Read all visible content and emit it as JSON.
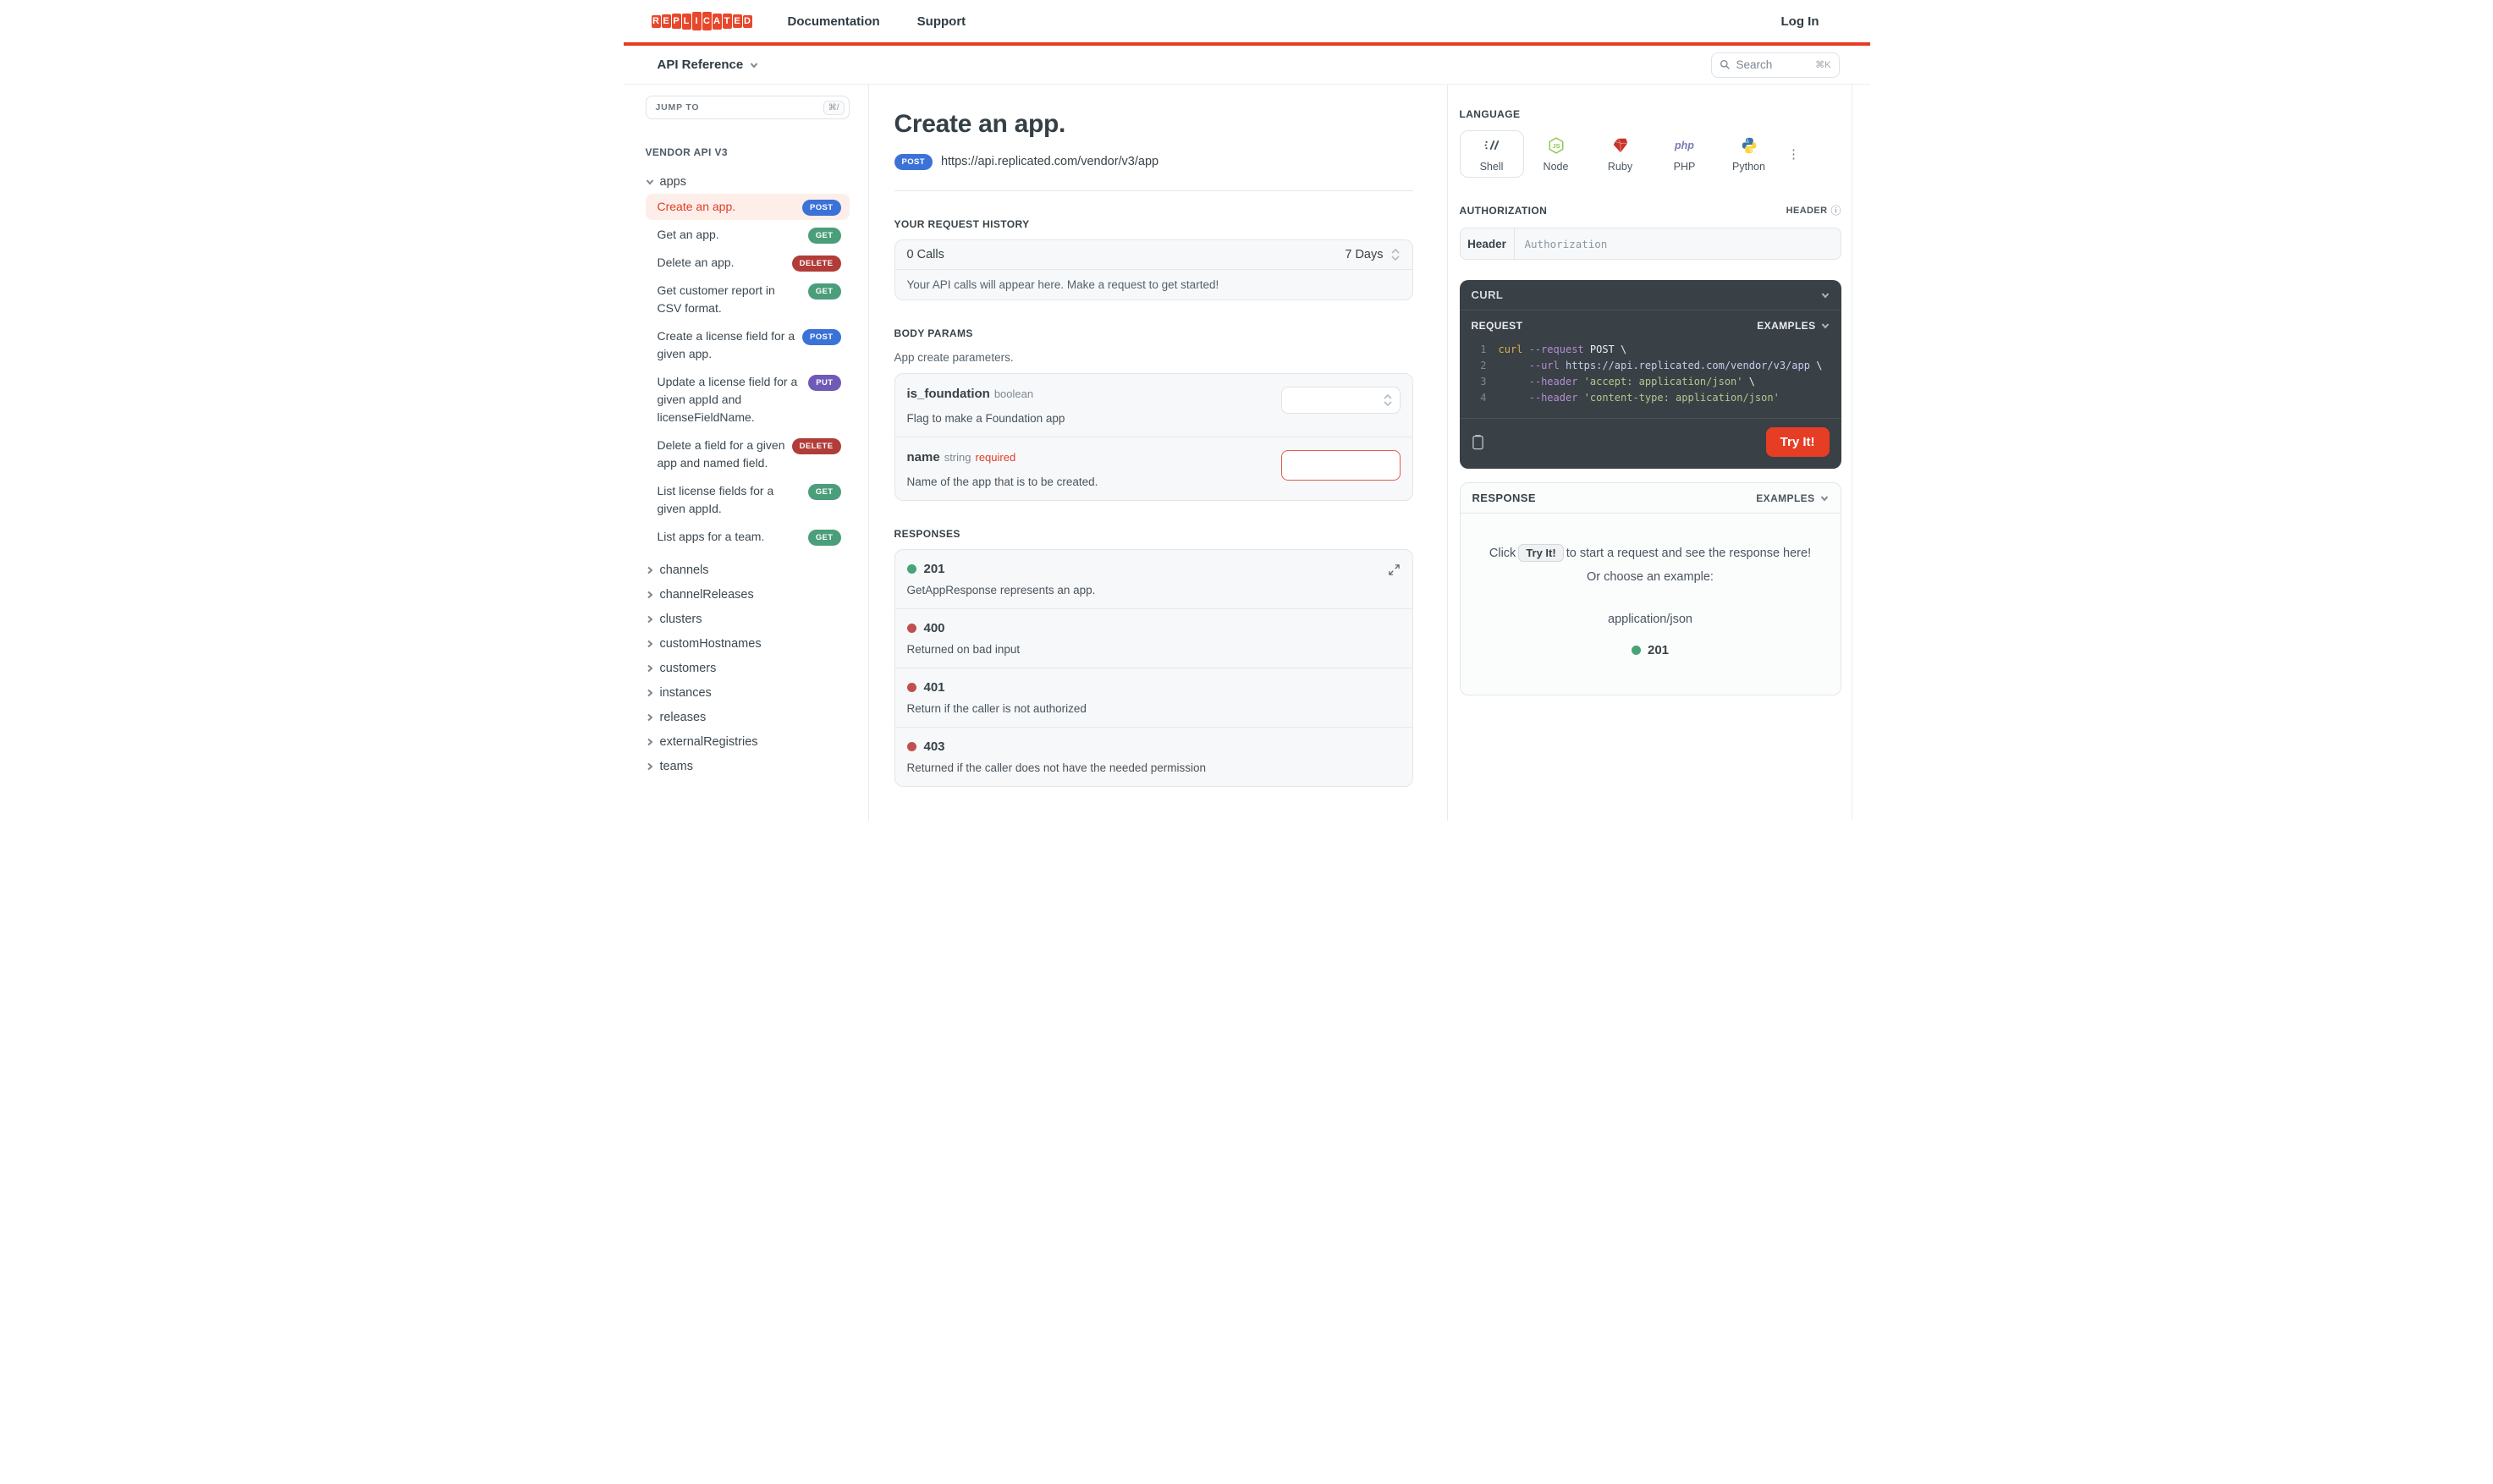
{
  "colors": {
    "accent_red": "#e63d25",
    "method_colors": {
      "POST": "#3b72d8",
      "GET": "#4a9e79",
      "DELETE": "#b13c38",
      "PUT": "#6f5bb5"
    },
    "status_green": "#47a477",
    "status_red": "#c0504e",
    "code": {
      "cmd": "#ddab4e",
      "flag": "#b58ed0",
      "plain": "#eceef0",
      "url": "#c9cdeb",
      "str": "#b5c78a"
    }
  },
  "header": {
    "logo_letters": [
      "R",
      "E",
      "P",
      "L",
      "I",
      "C",
      "A",
      "T",
      "E",
      "D"
    ],
    "nav": [
      {
        "label": "Documentation"
      },
      {
        "label": "Support"
      }
    ],
    "login_label": "Log In"
  },
  "subheader": {
    "title": "API Reference",
    "search": {
      "placeholder": "Search",
      "shortcut": "⌘K"
    }
  },
  "sidebar": {
    "jump_to": {
      "label": "JUMP TO",
      "shortcut": "⌘/"
    },
    "section_label": "VENDOR API V3",
    "group": {
      "label": "apps",
      "expanded": true,
      "items": [
        {
          "label": "Create an app.",
          "method": "POST",
          "active": true
        },
        {
          "label": "Get an app.",
          "method": "GET",
          "active": false
        },
        {
          "label": "Delete an app.",
          "method": "DELETE",
          "active": false
        },
        {
          "label": "Get customer report in CSV format.",
          "method": "GET",
          "active": false
        },
        {
          "label": "Create a license field for a given app.",
          "method": "POST",
          "active": false
        },
        {
          "label": "Update a license field for a given appId and licenseFieldName.",
          "method": "PUT",
          "active": false
        },
        {
          "label": "Delete a field for a given app and named field.",
          "method": "DELETE",
          "active": false
        },
        {
          "label": "List license fields for a given appId.",
          "method": "GET",
          "active": false
        },
        {
          "label": "List apps for a team.",
          "method": "GET",
          "active": false
        }
      ]
    },
    "collapsed_groups": [
      "channels",
      "channelReleases",
      "clusters",
      "customHostnames",
      "customers",
      "instances",
      "releases",
      "externalRegistries",
      "teams"
    ]
  },
  "main": {
    "title": "Create an app.",
    "endpoint": {
      "method": "POST",
      "url": "https://api.replicated.com/vendor/v3/app"
    },
    "request_history": {
      "heading": "YOUR REQUEST HISTORY",
      "calls": "0 Calls",
      "range": "7 Days",
      "empty_message": "Your API calls will appear here. Make a request to get started!"
    },
    "body_params": {
      "heading": "BODY PARAMS",
      "description": "App create parameters.",
      "params": [
        {
          "name": "is_foundation",
          "type": "boolean",
          "required": false,
          "required_label": "",
          "description": "Flag to make a Foundation app",
          "control": "select"
        },
        {
          "name": "name",
          "type": "string",
          "required": true,
          "required_label": "required",
          "description": "Name of the app that is to be created.",
          "control": "text"
        }
      ]
    },
    "responses": {
      "heading": "RESPONSES",
      "items": [
        {
          "code": "201",
          "status": "success",
          "description": "GetAppResponse represents an app."
        },
        {
          "code": "400",
          "status": "error",
          "description": "Returned on bad input"
        },
        {
          "code": "401",
          "status": "error",
          "description": "Return if the caller is not authorized"
        },
        {
          "code": "403",
          "status": "error",
          "description": "Returned if the caller does not have the needed permission"
        }
      ]
    }
  },
  "right": {
    "language": {
      "heading": "LANGUAGE",
      "options": [
        {
          "label": "Shell",
          "icon": "shell",
          "selected": true
        },
        {
          "label": "Node",
          "icon": "node",
          "selected": false
        },
        {
          "label": "Ruby",
          "icon": "ruby",
          "selected": false
        },
        {
          "label": "PHP",
          "icon": "php",
          "selected": false
        },
        {
          "label": "Python",
          "icon": "python",
          "selected": false
        }
      ]
    },
    "authorization": {
      "heading": "AUTHORIZATION",
      "type_label": "HEADER",
      "field_label": "Header",
      "placeholder": "Authorization"
    },
    "curl_panel": {
      "title": "CURL",
      "request_label": "REQUEST",
      "examples_label": "EXAMPLES",
      "try_it_label": "Try It!",
      "code": [
        {
          "num": "1",
          "tokens": [
            {
              "text": "curl ",
              "style": "cmd"
            },
            {
              "text": "--request",
              "style": "flag"
            },
            {
              "text": " POST \\",
              "style": "plain"
            }
          ]
        },
        {
          "num": "2",
          "tokens": [
            {
              "text": "     ",
              "style": "plain"
            },
            {
              "text": "--url",
              "style": "flag"
            },
            {
              "text": " https://api.replicated.com/vendor/v3/app",
              "style": "url"
            },
            {
              "text": " \\",
              "style": "plain"
            }
          ]
        },
        {
          "num": "3",
          "tokens": [
            {
              "text": "     ",
              "style": "plain"
            },
            {
              "text": "--header",
              "style": "flag"
            },
            {
              "text": " 'accept: application/json'",
              "style": "str"
            },
            {
              "text": " \\",
              "style": "plain"
            }
          ]
        },
        {
          "num": "4",
          "tokens": [
            {
              "text": "     ",
              "style": "plain"
            },
            {
              "text": "--header",
              "style": "flag"
            },
            {
              "text": " 'content-type: application/json'",
              "style": "str"
            }
          ]
        }
      ]
    },
    "response_panel": {
      "title": "RESPONSE",
      "examples_label": "EXAMPLES",
      "hint_pre": "Click",
      "hint_button": "Try It!",
      "hint_post": "to start a request and see the response here!",
      "hint_line2": "Or choose an example:",
      "example_type": "application/json",
      "example_code": "201",
      "example_status": "success"
    }
  }
}
